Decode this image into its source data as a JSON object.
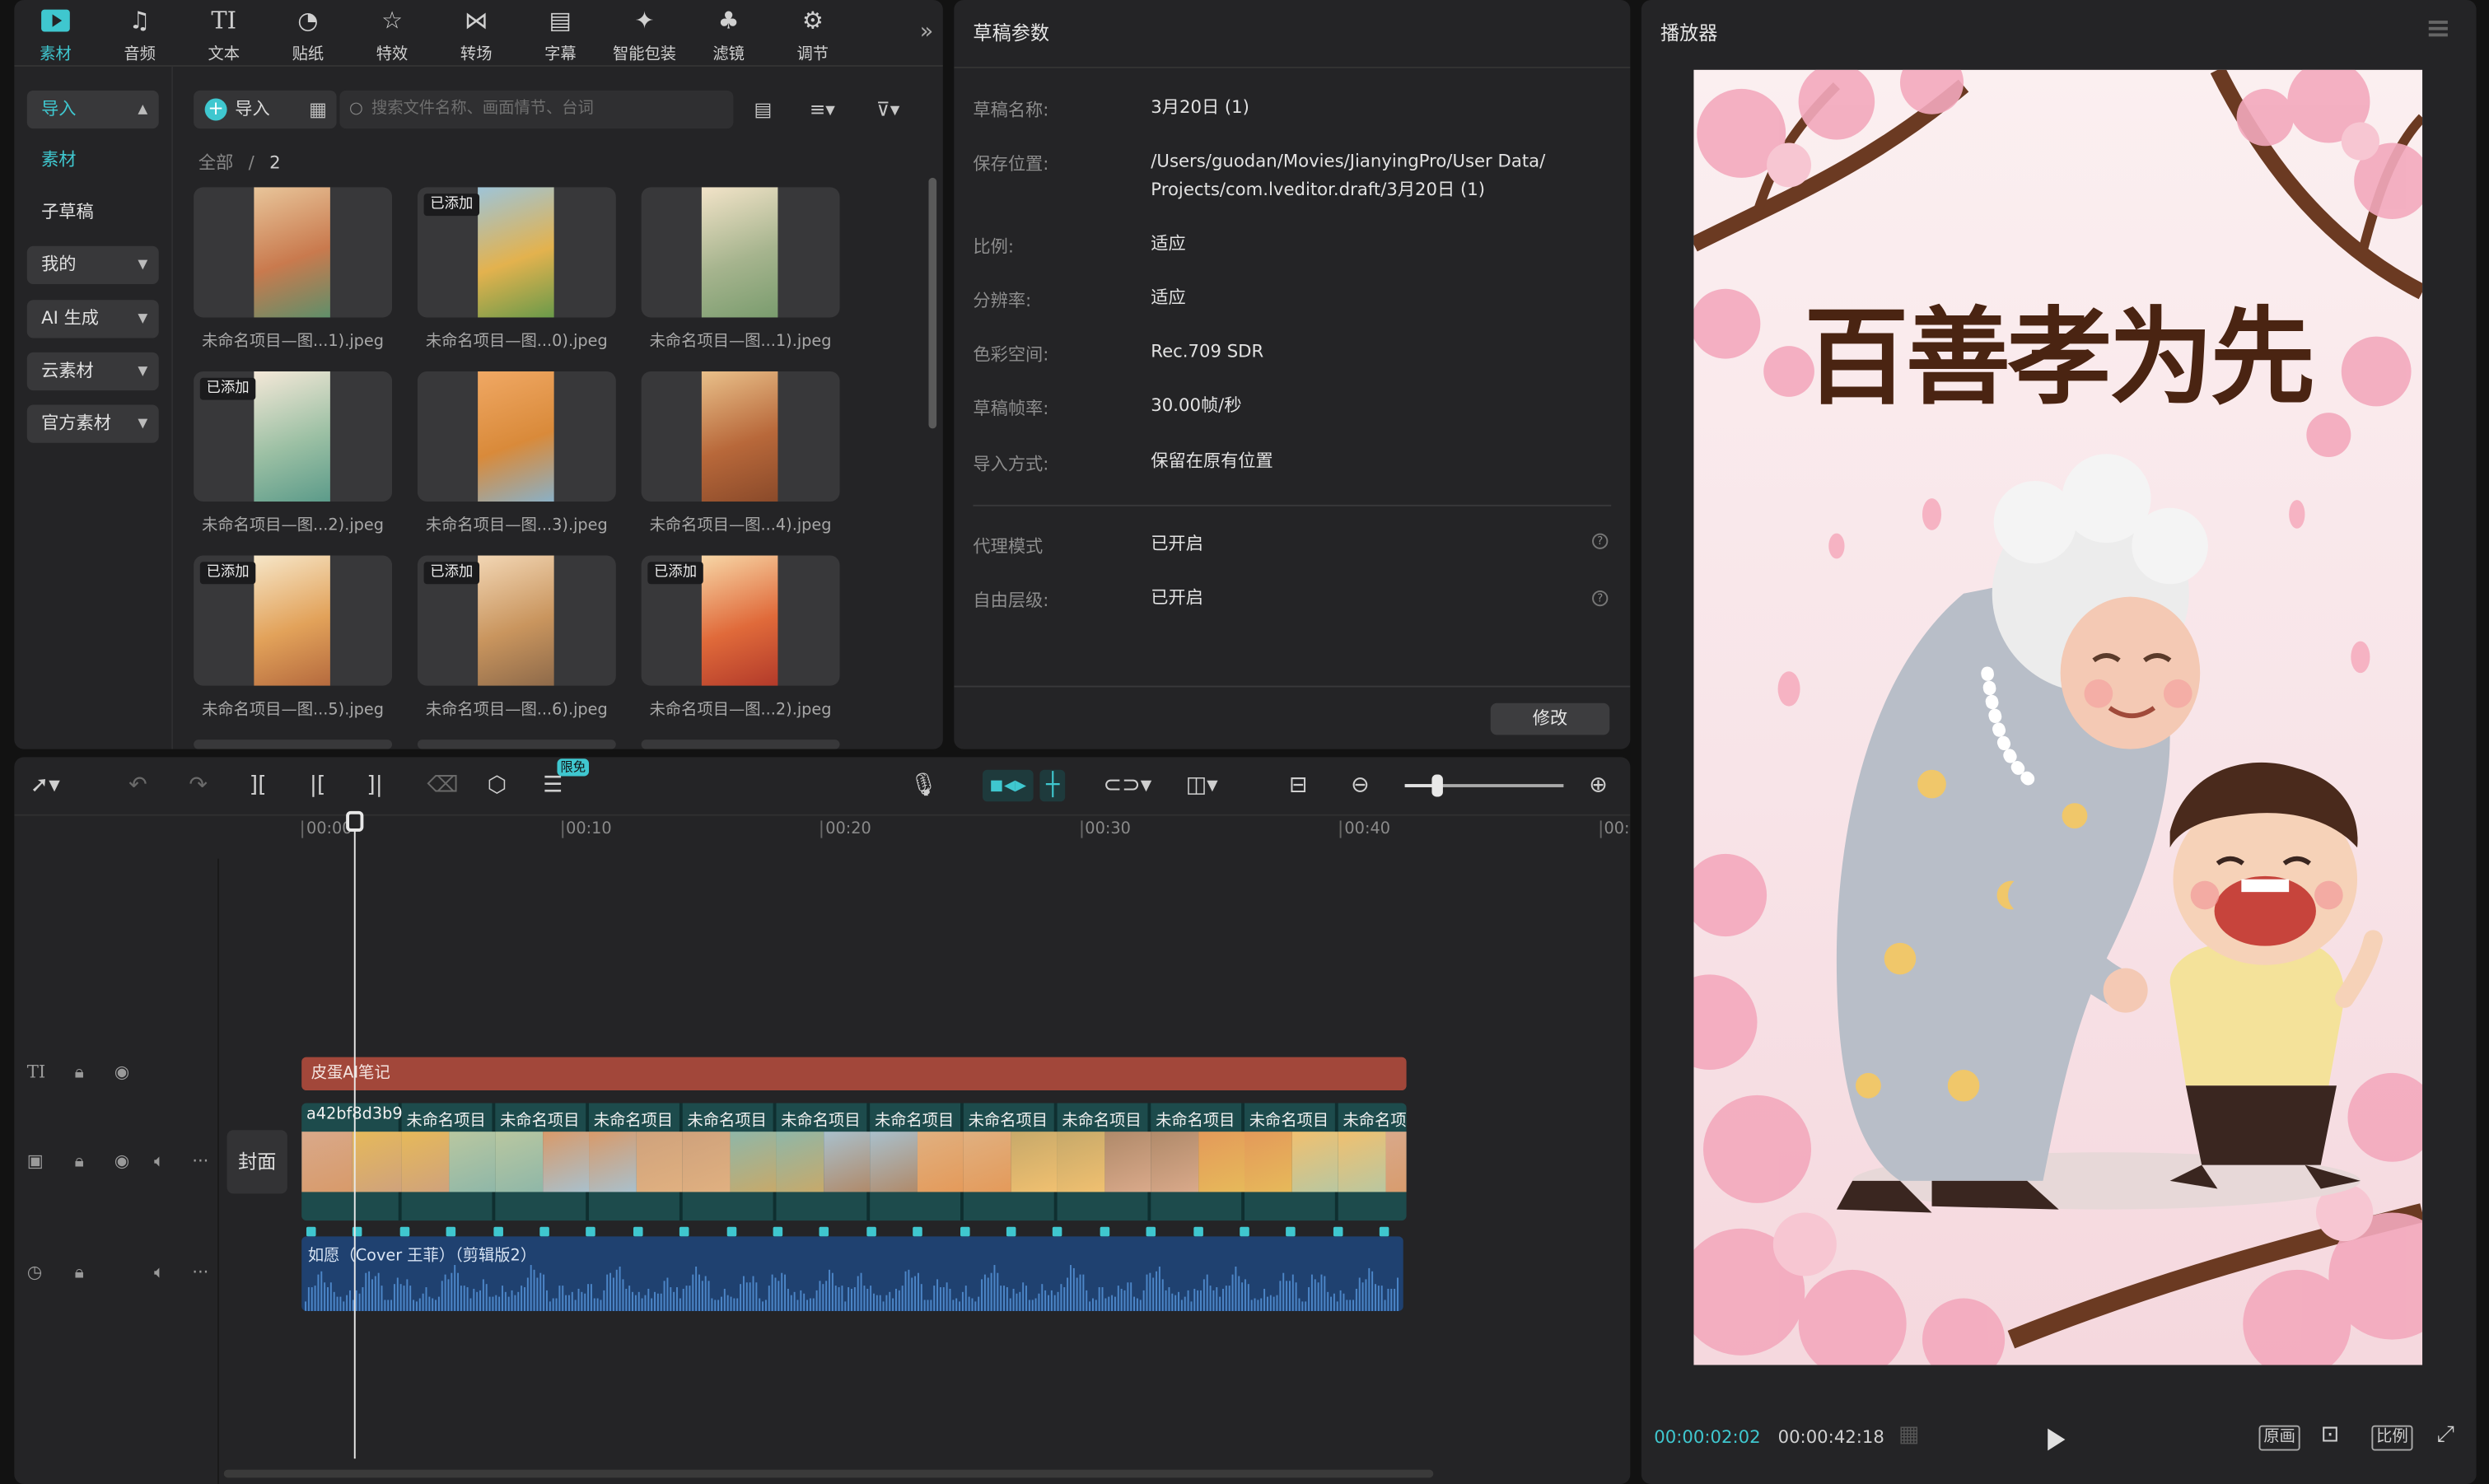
{
  "media_toolbar": {
    "tools": [
      {
        "label": "素材",
        "icon": "media-icon",
        "active": true
      },
      {
        "label": "音频",
        "icon": "music-icon"
      },
      {
        "label": "文本",
        "icon": "text-icon"
      },
      {
        "label": "贴纸",
        "icon": "sticker-icon"
      },
      {
        "label": "特效",
        "icon": "effects-icon"
      },
      {
        "label": "转场",
        "icon": "transition-icon"
      },
      {
        "label": "字幕",
        "icon": "subtitle-icon"
      },
      {
        "label": "智能包装",
        "icon": "smart-pack-icon"
      },
      {
        "label": "滤镜",
        "icon": "filter-icon"
      },
      {
        "label": "调节",
        "icon": "adjust-icon"
      }
    ],
    "more": "»"
  },
  "sidebar": {
    "items": [
      {
        "label": "导入"
      },
      {
        "label": "素材"
      },
      {
        "label": "子草稿"
      },
      {
        "label": "我的"
      },
      {
        "label": "AI 生成"
      },
      {
        "label": "云素材"
      },
      {
        "label": "官方素材"
      }
    ]
  },
  "library": {
    "import_label": "导入",
    "search_placeholder": "搜索文件名称、画面情节、台词",
    "breadcrumb_root": "全部",
    "breadcrumb_sep": "/",
    "breadcrumb_count": "2",
    "added_badge": "已添加",
    "items": [
      {
        "name": "未命名项目—图...1).jpeg",
        "added": false
      },
      {
        "name": "未命名项目—图...0).jpeg",
        "added": true
      },
      {
        "name": "未命名项目—图...1).jpeg",
        "added": false
      },
      {
        "name": "未命名项目—图...2).jpeg",
        "added": true
      },
      {
        "name": "未命名项目—图...3).jpeg",
        "added": false
      },
      {
        "name": "未命名项目—图...4).jpeg",
        "added": false
      },
      {
        "name": "未命名项目—图...5).jpeg",
        "added": true
      },
      {
        "name": "未命名项目—图...6).jpeg",
        "added": true
      },
      {
        "name": "未命名项目—图...2).jpeg",
        "added": true
      }
    ]
  },
  "draft": {
    "title": "草稿参数",
    "fields": [
      {
        "label": "草稿名称:",
        "value": "3月20日 (1)"
      },
      {
        "label": "保存位置:",
        "value": "/Users/guodan/Movies/JianyingPro/User Data/ Projects/com.lveditor.draft/3月20日 (1)"
      },
      {
        "label": "比例:",
        "value": "适应"
      },
      {
        "label": "分辨率:",
        "value": "适应"
      },
      {
        "label": "色彩空间:",
        "value": "Rec.709 SDR"
      },
      {
        "label": "草稿帧率:",
        "value": "30.00帧/秒"
      },
      {
        "label": "导入方式:",
        "value": "保留在原有位置"
      }
    ],
    "extra": [
      {
        "label": "代理模式",
        "value": "已开启"
      },
      {
        "label": "自由层级:",
        "value": "已开启"
      }
    ],
    "modify_label": "修改"
  },
  "player": {
    "title": "播放器",
    "preview_text": "百善孝为先",
    "current_time": "00:00:02:02",
    "total_time": "00:00:42:18",
    "original_label": "原画",
    "ratio_label": "比例"
  },
  "timeline": {
    "free_badge": "限免",
    "ticks": [
      "00:00",
      "00:10",
      "00:20",
      "00:30",
      "00:40",
      "00:"
    ],
    "text_clip": "皮蛋AI笔记",
    "cover_label": "封面",
    "video_clips": [
      "a42bf8d3b9",
      "未命名项目",
      "未命名项目",
      "未命名项目",
      "未命名项目",
      "未命名项目",
      "未命名项目",
      "未命名项目",
      "未命名项目",
      "未命名项目",
      "未命名项目",
      "未命名项"
    ],
    "audio_clip": "如愿（Cover 王菲）（剪辑版2）",
    "playhead_time_s": 2.07
  },
  "colors": {
    "accent": "#3fc7cf",
    "text_clip": "#a2473a",
    "video_track": "#1d4b4c",
    "audio_track": "#1f4170"
  }
}
